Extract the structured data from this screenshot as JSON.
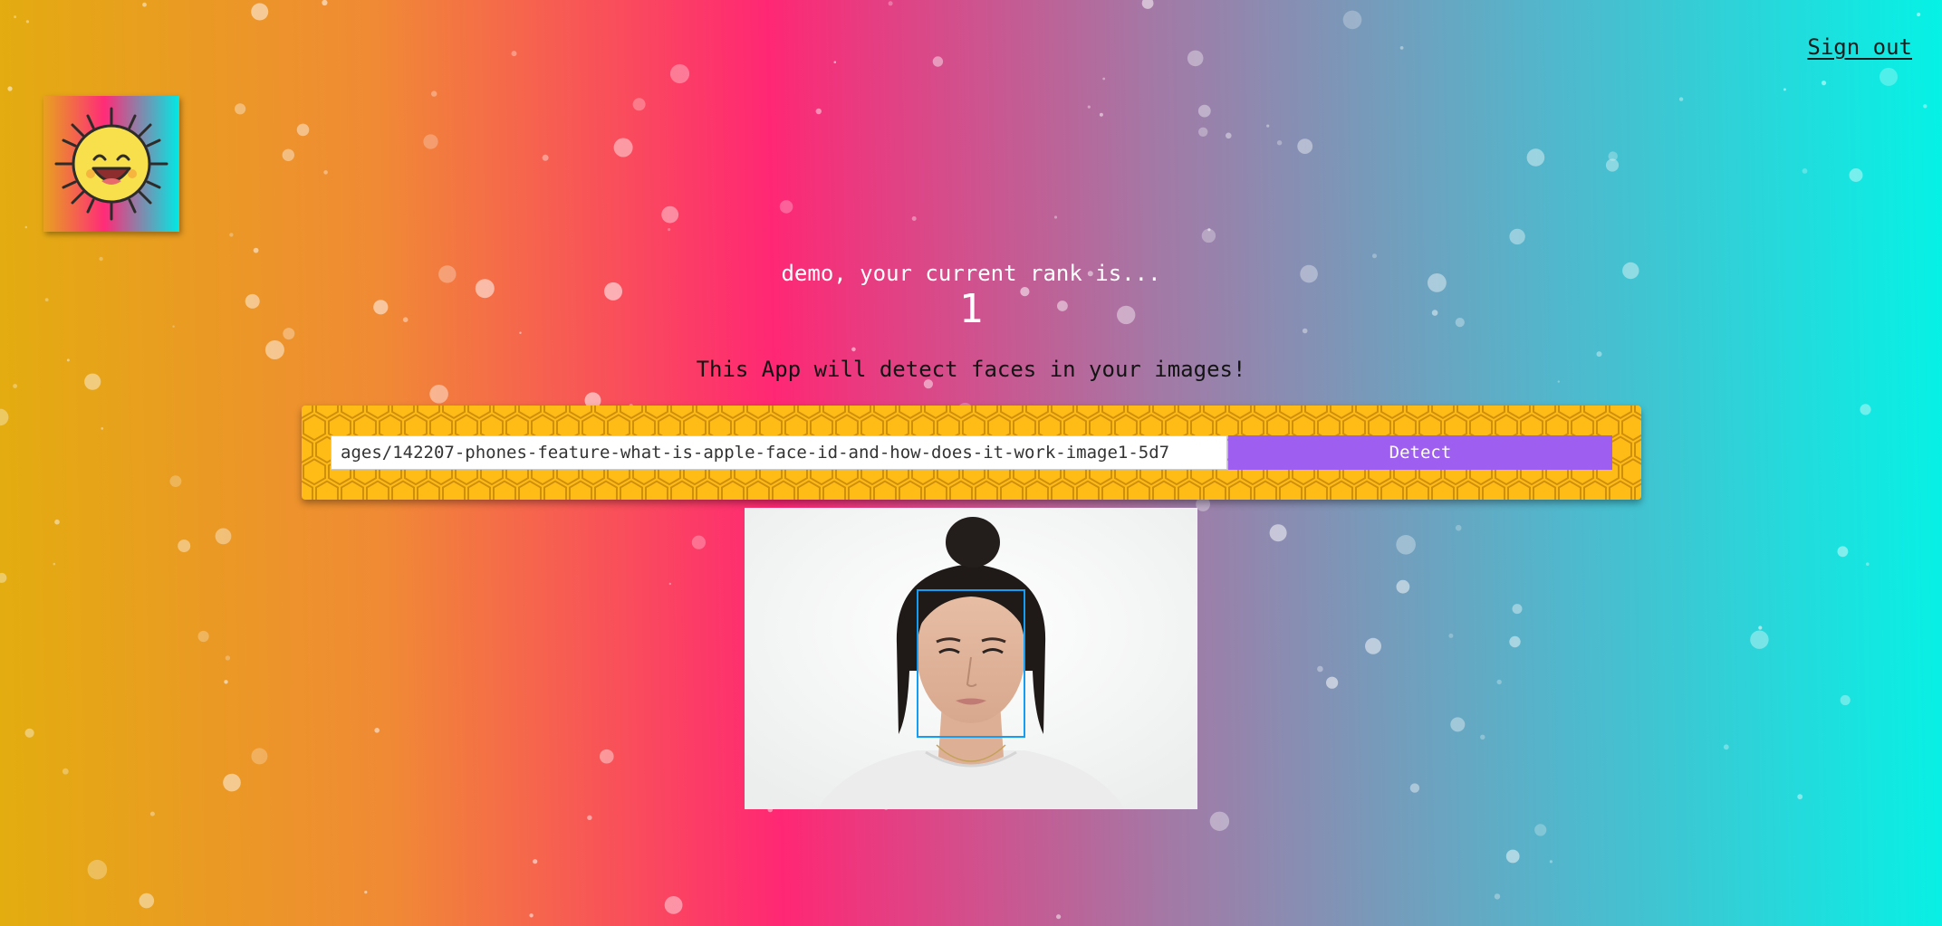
{
  "header": {
    "sign_out_label": "Sign out"
  },
  "logo": {
    "icon": "smiling-sun-icon"
  },
  "rank": {
    "message": "demo, your current rank is...",
    "value": "1"
  },
  "intro": {
    "text": "This App will detect faces in your images!"
  },
  "detect_form": {
    "image_url_value": "ages/142207-phones-feature-what-is-apple-face-id-and-how-does-it-work-image1-5d7",
    "detect_label": "Detect"
  },
  "result": {
    "image": "portrait-photo",
    "face_boxes": 1
  },
  "colors": {
    "panel": "#ffbb16",
    "button": "#9e5ff0",
    "face_box": "#149df2",
    "gradient": [
      "#e3ad0f",
      "#ff2774",
      "#a27aa6",
      "#05f2e6"
    ]
  }
}
